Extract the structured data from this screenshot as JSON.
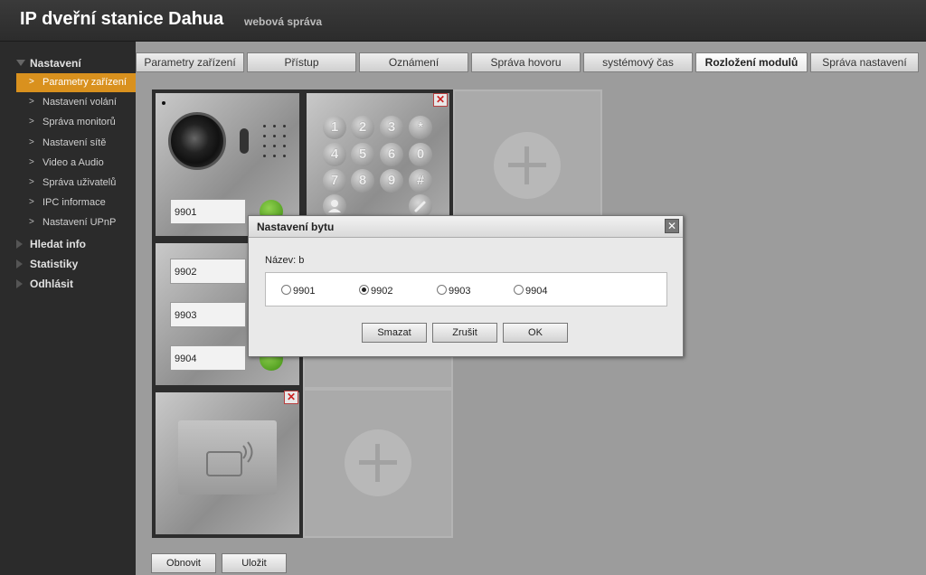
{
  "header": {
    "title": "IP dveřní stanice Dahua",
    "subtitle": "webová správa"
  },
  "sidebar": {
    "sections": [
      {
        "label": "Nastavení",
        "expanded": true
      },
      {
        "label": "Hledat info",
        "expanded": false
      },
      {
        "label": "Statistiky",
        "expanded": false
      },
      {
        "label": "Odhlásit",
        "expanded": false
      }
    ],
    "items": [
      {
        "label": "Parametry zařízení",
        "active": true
      },
      {
        "label": "Nastavení volání"
      },
      {
        "label": "Správa monitorů"
      },
      {
        "label": "Nastavení sítě"
      },
      {
        "label": "Video a Audio"
      },
      {
        "label": "Správa uživatelů"
      },
      {
        "label": "IPC informace"
      },
      {
        "label": "Nastavení UPnP"
      }
    ]
  },
  "tabs": [
    {
      "label": "Parametry zařízení"
    },
    {
      "label": "Přístup"
    },
    {
      "label": "Oznámení"
    },
    {
      "label": "Správa hovoru"
    },
    {
      "label": "systémový čas"
    },
    {
      "label": "Rozložení modulů",
      "active": true
    },
    {
      "label": "Správa nastavení"
    }
  ],
  "modules": {
    "camera_field": "9901",
    "button_fields": [
      "9902",
      "9903",
      "9904"
    ],
    "keypad": [
      "1",
      "2",
      "3",
      "*",
      "4",
      "5",
      "6",
      "0",
      "7",
      "8",
      "9",
      "#"
    ]
  },
  "buttons": {
    "refresh": "Obnovit",
    "save": "Uložit"
  },
  "dialog": {
    "title": "Nastavení bytu",
    "name_label": "Název: b",
    "options": [
      {
        "label": "9901",
        "checked": false
      },
      {
        "label": "9902",
        "checked": true
      },
      {
        "label": "9903",
        "checked": false
      },
      {
        "label": "9904",
        "checked": false
      }
    ],
    "buttons": {
      "delete": "Smazat",
      "cancel": "Zrušit",
      "ok": "OK"
    }
  },
  "colors": {
    "accent": "#d9911e",
    "header_bg": "#333333",
    "sidebar_bg": "#2b2b2b",
    "content_bg": "#9c9c9c"
  }
}
